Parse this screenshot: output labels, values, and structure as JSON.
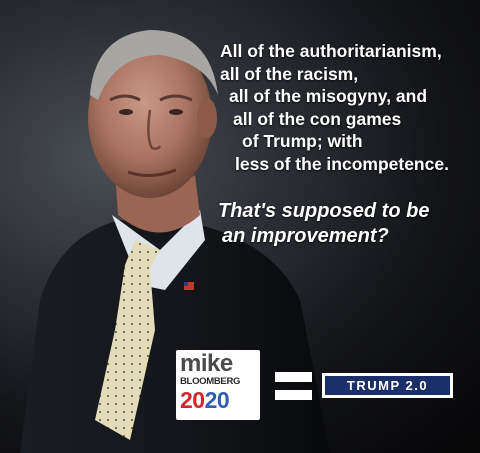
{
  "quote_lines": [
    "All of the authoritarianism,",
    "all of the racism,",
    "all of the misogyny, and",
    "all of the con games",
    "of Trump; with",
    "less of the incompetence."
  ],
  "question_lines": [
    "That's supposed to be",
    "an improvement?"
  ],
  "logo": {
    "name": "mike",
    "surname": "BLOOMBERG",
    "year_part1": "20",
    "year_part2": "20"
  },
  "trump_badge": "TRUMP 2.0",
  "colors": {
    "background": "#0b0b0d",
    "text": "#ffffff",
    "logo_red": "#d5262c",
    "logo_blue": "#2f5fb3",
    "badge_navy": "#1b2f6b"
  }
}
